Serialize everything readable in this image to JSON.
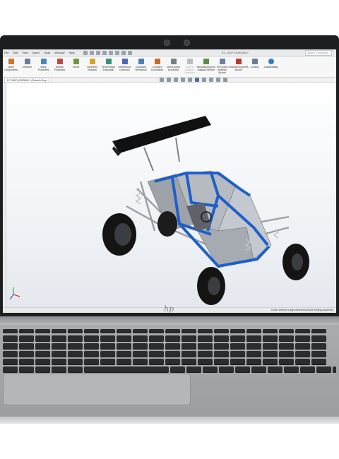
{
  "app": {
    "window_title": "EC-180P ASSEMBLY",
    "menu": [
      "File",
      "Edit",
      "View",
      "Insert",
      "Tools",
      "Window",
      "Help"
    ],
    "search_placeholder": "Search Commands"
  },
  "ribbon": {
    "items": [
      {
        "label": "Insert Components",
        "icon": "insert-components-icon",
        "color": "#c9752f",
        "enabled": true
      },
      {
        "label": "Measure",
        "icon": "measure-icon",
        "color": "#6a7d94",
        "enabled": true
      },
      {
        "label": "Mass Properties",
        "icon": "mass-properties-icon",
        "color": "#4b83c3",
        "enabled": true
      },
      {
        "label": "Section Properties",
        "icon": "section-properties-icon",
        "color": "#b94b45",
        "enabled": true
      },
      {
        "label": "Check",
        "icon": "check-icon",
        "color": "#6b9b3c",
        "enabled": true
      },
      {
        "label": "Geometry Analysis",
        "icon": "geometry-analysis-icon",
        "color": "#d6a12b",
        "enabled": true
      },
      {
        "label": "Performance Evaluation",
        "icon": "performance-evaluation-icon",
        "color": "#3d8e76",
        "enabled": true
      },
      {
        "label": "Interference Detection",
        "icon": "interference-detection-icon",
        "color": "#4a67b0",
        "enabled": true
      },
      {
        "label": "Clearance Verification",
        "icon": "clearance-verification-icon",
        "color": "#4f7db8",
        "enabled": true
      },
      {
        "label": "Compare Documents",
        "icon": "compare-documents-icon",
        "color": "#c96a2a",
        "enabled": true
      },
      {
        "label": "Check Active Document",
        "icon": "check-active-document-icon",
        "color": "#7a7f86",
        "enabled": true
      },
      {
        "label": "Add-ins Collision Detection",
        "icon": "collision-detection-icon",
        "color": "#b9bdc2",
        "enabled": false
      },
      {
        "label": "SimulationXpress Analysis Wizard",
        "icon": "simulationxpress-icon",
        "color": "#5a8b47",
        "enabled": true
      },
      {
        "label": "FloXpress Analysis Wizard",
        "icon": "floxpress-icon",
        "color": "#6d7fa3",
        "enabled": true
      },
      {
        "label": "DriveWorksXpress Wizard",
        "icon": "driveworksxpress-icon",
        "color": "#b8352d",
        "enabled": true
      },
      {
        "label": "Costing",
        "icon": "costing-icon",
        "color": "#6b7c8f",
        "enabled": true
      },
      {
        "label": "Sustainability",
        "icon": "sustainability-icon",
        "color": "#2f7fc4",
        "enabled": true
      }
    ]
  },
  "document_tab": {
    "label": "EC-180P ASSEMBLY (Default<Disp...)"
  },
  "status_bar": {
    "text": "Under Defined   Large Assembly Mode   Editing Assembly"
  },
  "device": {
    "brand_mark": "hp"
  },
  "colors": {
    "frame_blue": "#1f5fc8",
    "panel_gray": "#9ea3aa",
    "tire": "#141414",
    "wing": "#111111"
  }
}
